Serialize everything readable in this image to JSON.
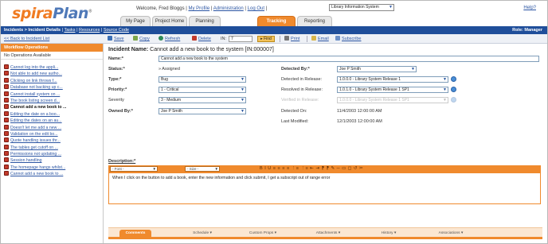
{
  "app": {
    "logo_part1": "spira",
    "logo_part2": "Plan",
    "logo_tm": "®",
    "help": "Help?"
  },
  "welcome": {
    "prefix": "Welcome, Fred Bloggs |",
    "my_profile": "My Profile",
    "sep1": "|",
    "administration": "Administration",
    "sep2": "|",
    "logout": "Log Out",
    "sep3": "|",
    "project": "Library Information System"
  },
  "tabs": [
    {
      "label": "My Page"
    },
    {
      "label": "Project Home"
    },
    {
      "label": "Planning"
    },
    {
      "label": "Tracking"
    },
    {
      "label": "Reporting"
    }
  ],
  "navbar": {
    "crumb": "Incidents > Incident Details",
    "sep": "|",
    "tasks": "Tasks",
    "resources": "Resources",
    "source_code": "Source Code",
    "role": "Role: Manager"
  },
  "toolbar": {
    "back": "<< Back to Incident List",
    "save": "Save",
    "copy": "Copy",
    "refresh": "Refresh",
    "delete": "Delete",
    "find_prefix": "IN:",
    "find_value": "7",
    "find": "Find",
    "print": "Print",
    "email": "Email",
    "subscribe": "Subscribe"
  },
  "sidebar": {
    "heading": "Workflow Operations",
    "no_ops": "No Operations Available",
    "items": [
      "Cannot log into the appli...",
      "Not able to add new autho...",
      "Clicking on link throws f...",
      "Database not backing up c...",
      "Cannot install system on ...",
      "The book listing screen d...",
      "Cannot add a new book to ...",
      "Editing the date on a boo...",
      "Editing the dates on an au...",
      "Doesn't let me add a new ...",
      "Validation on the edit bo...",
      "Quote handling issues thr...",
      "The tables get cutoff on ...",
      "Permissions not updating ...",
      "Session handling",
      "The homepage hangs whilst...",
      "Cannot add a new book to ..."
    ],
    "current_index": 6
  },
  "incident": {
    "title_label": "Incident Name:",
    "title_value": "Cannot add a new book to the system [IN:000007]",
    "name_label": "Name:*",
    "name_value": "Cannot add a new book to the system",
    "status_label": "Status:*",
    "status_value": "» Assigned",
    "type_label": "Type:*",
    "type_value": "Bug",
    "priority_label": "Priority:*",
    "priority_value": "1 - Critical",
    "severity_label": "Severity",
    "severity_value": "3 - Medium",
    "owned_label": "Owned By:*",
    "owned_value": "Joe P Smith",
    "detected_by_label": "Detected By:*",
    "detected_by_value": "Joe P Smith",
    "det_release_label": "Detected in Release:",
    "det_release_value": "1.0.0.0 - Library System Release 1",
    "res_release_label": "Resolved in Release:",
    "res_release_value": "1.0.1.0 - Library System Release 1 SP1",
    "ver_release_label": "Verified in Release:",
    "ver_release_value": "1.0.0.0 - Library System Release 1 SP1",
    "detected_on_label": "Detected On:",
    "detected_on_value": "11/4/2003 12:00:00 AM",
    "last_modified_label": "Last Modified:",
    "last_modified_value": "12/1/2003 12:00:00 AM",
    "description_label": "Description:*",
    "font_select": "- Font -",
    "size_select": "- Size -",
    "rte_buttons": "B I U  ≡ ≡ ≡ ≡  ⋮≡ ⋮≡ ⇤ ⇥  ⁋ ⁋  ✎ ─ ▭ ◻ ↺ ✂",
    "description_text": "When I click on the button to add a book, enter the new information and click submit, I get a subscript out of range error"
  },
  "bottom_tabs": [
    {
      "label": "Comments"
    },
    {
      "label": "Schedule ▾"
    },
    {
      "label": "Custom Props ▾"
    },
    {
      "label": "Attachments ▾"
    },
    {
      "label": "History ▾"
    },
    {
      "label": "Associations ▾"
    }
  ],
  "colors": {
    "orange": "#f08a2d",
    "navy": "#1f4e9a",
    "link": "#2b55a3"
  }
}
